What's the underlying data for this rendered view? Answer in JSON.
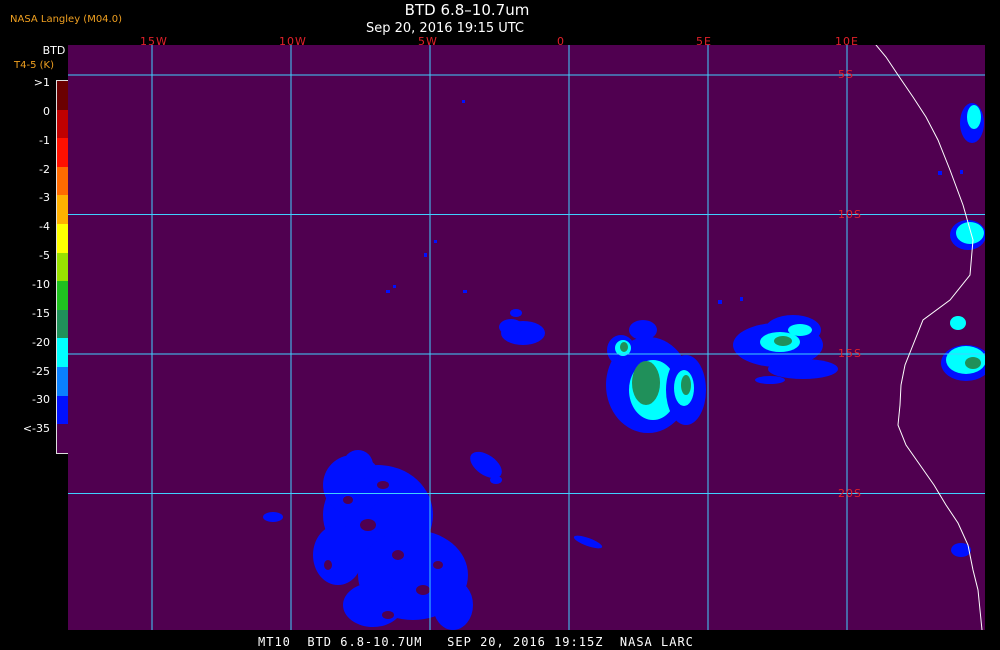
{
  "credit": "NASA Langley (M04.0)",
  "title": "BTD 6.8–10.7um",
  "subtitle": "Sep 20, 2016 19:15 UTC",
  "footer": "MT10  BTD 6.8-10.7UM   SEP 20, 2016 19:15Z  NASA LARC",
  "legend": {
    "heading": "BTD",
    "unit": "T4-5 (K)",
    "labels": [
      ">1",
      "0",
      "-1",
      "-2",
      "-3",
      "-4",
      "-5",
      "-10",
      "-15",
      "-20",
      "-25",
      "-30",
      "<-35"
    ],
    "colors": [
      "#6b0000",
      "#c00000",
      "#ff1000",
      "#ff6a00",
      "#ffb000",
      "#ffff00",
      "#99e000",
      "#20c020",
      "#20905a",
      "#00ffff",
      "#0a80ff",
      "#0010ff",
      "#500050"
    ]
  },
  "grid": {
    "longitudes": [
      {
        "label": "15W",
        "value": -15
      },
      {
        "label": "10W",
        "value": -10
      },
      {
        "label": "5W",
        "value": -5
      },
      {
        "label": "0",
        "value": 0
      },
      {
        "label": "5E",
        "value": 5
      },
      {
        "label": "10E",
        "value": 10
      }
    ],
    "latitudes": [
      {
        "label": "5S",
        "value": -5
      },
      {
        "label": "10S",
        "value": -10
      },
      {
        "label": "15S",
        "value": -15
      },
      {
        "label": "20S",
        "value": -20
      }
    ],
    "line_color": "#40d0ff"
  },
  "colors": {
    "background": "#500050",
    "coast": "#ffffff",
    "low_cloud": "#0010ff",
    "mid_cloud": "#00ffff",
    "high_cloud": "#20905a"
  }
}
